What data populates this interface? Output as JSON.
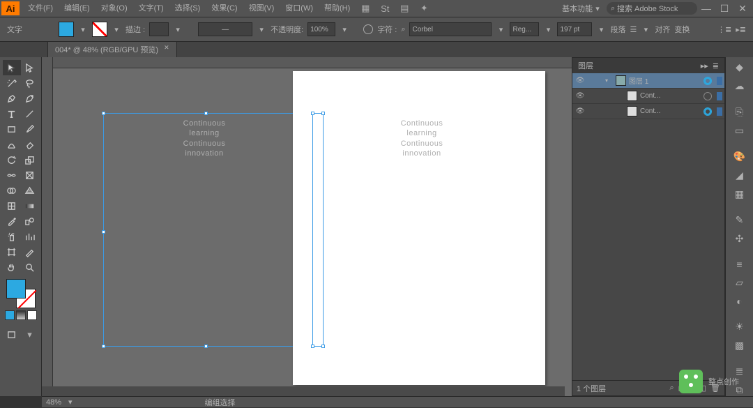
{
  "app": {
    "logo": "Ai"
  },
  "menus": [
    "文件(F)",
    "编辑(E)",
    "对象(O)",
    "文字(T)",
    "选择(S)",
    "效果(C)",
    "视图(V)",
    "窗口(W)",
    "帮助(H)"
  ],
  "workspace": {
    "label": "基本功能"
  },
  "stock_search": {
    "placeholder": "搜索 Adobe Stock"
  },
  "options": {
    "tool_label": "文字",
    "stroke_label": "描边 :",
    "stroke_dash": "—",
    "opacity_label": "不透明度:",
    "opacity_value": "100%",
    "char_label": "字符 :",
    "font": "Corbel",
    "weight": "Reg...",
    "size": "197 pt",
    "para_label": "段落",
    "align_label": "对齐",
    "transform_label": "变换"
  },
  "document": {
    "tab": "004* @ 48% (RGB/GPU 预览)"
  },
  "canvas": {
    "text_lines": [
      "Continuous",
      "learning",
      "Continuous",
      "innovation"
    ]
  },
  "layers": {
    "tab": "图层",
    "rows": [
      {
        "name": "图层 1",
        "indent": 0,
        "sel": true,
        "thumb": "t1",
        "target": true
      },
      {
        "name": "Cont...",
        "indent": 1,
        "sel": false,
        "thumb": "t2",
        "target": false
      },
      {
        "name": "Cont...",
        "indent": 1,
        "sel": false,
        "thumb": "t2",
        "target": true
      }
    ],
    "footer": "1 个图层"
  },
  "status": {
    "zoom": "48%",
    "center": "编组选择"
  },
  "watermark": "整点创作"
}
